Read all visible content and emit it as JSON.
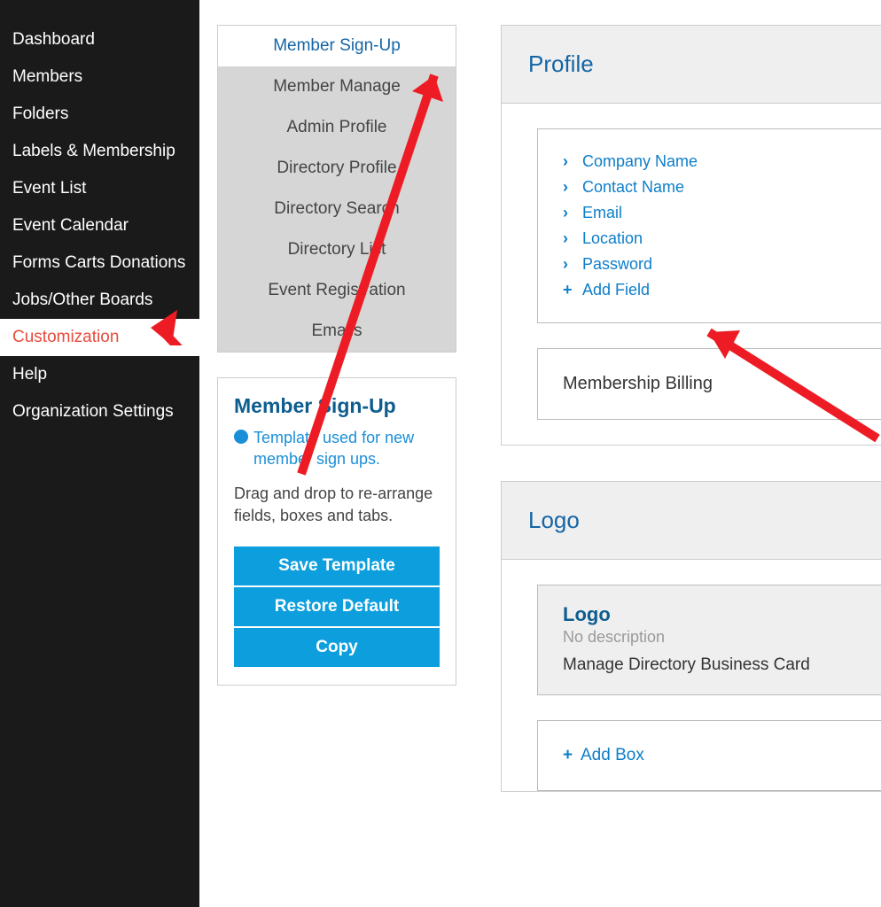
{
  "sidebar": {
    "items": [
      {
        "label": "Dashboard",
        "active": false
      },
      {
        "label": "Members",
        "active": false
      },
      {
        "label": "Folders",
        "active": false
      },
      {
        "label": "Labels & Membership",
        "active": false
      },
      {
        "label": "Event List",
        "active": false
      },
      {
        "label": "Event Calendar",
        "active": false
      },
      {
        "label": "Forms Carts Donations",
        "active": false
      },
      {
        "label": "Jobs/Other Boards",
        "active": false
      },
      {
        "label": "Customization",
        "active": true
      },
      {
        "label": "Help",
        "active": false
      },
      {
        "label": "Organization Settings",
        "active": false
      }
    ]
  },
  "nav": {
    "items": [
      {
        "label": "Member Sign-Up",
        "selected": true
      },
      {
        "label": "Member Manage",
        "selected": false
      },
      {
        "label": "Admin Profile",
        "selected": false
      },
      {
        "label": "Directory Profile",
        "selected": false
      },
      {
        "label": "Directory Search",
        "selected": false
      },
      {
        "label": "Directory List",
        "selected": false
      },
      {
        "label": "Event Registration",
        "selected": false
      },
      {
        "label": "Emails",
        "selected": false
      }
    ]
  },
  "panel": {
    "title": "Member Sign-Up",
    "description": "Template used for new member sign ups.",
    "help": "Drag and drop to re-arrange fields, boxes and tabs.",
    "buttons": {
      "save": "Save Template",
      "restore": "Restore Default",
      "copy": "Copy"
    }
  },
  "profile": {
    "header": "Profile",
    "fields": [
      "Company Name",
      "Contact Name",
      "Email",
      "Location",
      "Password"
    ],
    "add_field": "Add Field",
    "billing": "Membership Billing"
  },
  "logo": {
    "header": "Logo",
    "card_title": "Logo",
    "card_subtitle": "No description",
    "card_action": "Manage Directory Business Card",
    "add_box": "Add Box"
  }
}
